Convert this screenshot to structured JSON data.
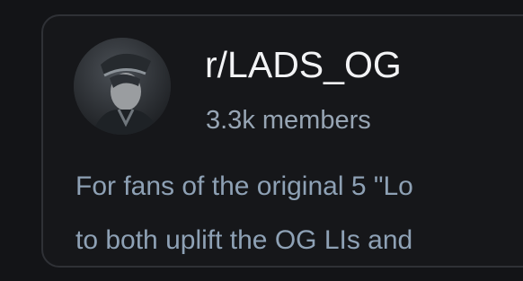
{
  "community": {
    "name": "r/LADS_OG",
    "members": "3.3k members",
    "description_lines": [
      "For fans of the original 5 \"Lo",
      "to both uplift the OG LIs and"
    ]
  },
  "avatar": {
    "icon": "community-avatar"
  },
  "colors": {
    "background": "#131417",
    "card_border": "#2f3136",
    "title": "#f2f3f5",
    "muted": "#97a5b4"
  }
}
